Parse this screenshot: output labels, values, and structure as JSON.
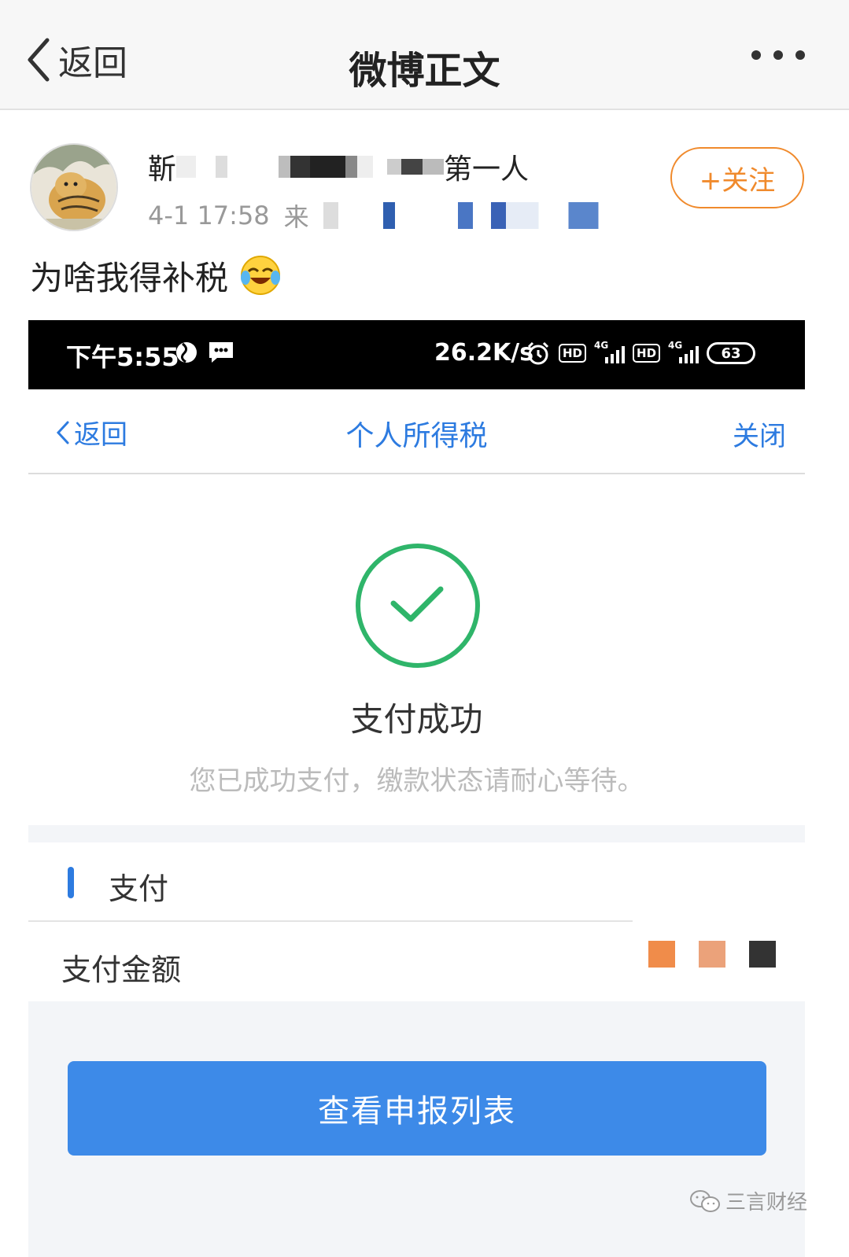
{
  "weibo_nav": {
    "back_label": "返回",
    "title": "微博正文"
  },
  "post": {
    "author_visible_start": "靳",
    "author_visible_end": "第一人",
    "time": "4-1 17:58",
    "source_prefix": "来",
    "follow_label": "+关注",
    "text": "为啥我得补税"
  },
  "status_bar": {
    "time": "下午5:55",
    "speed": "26.2K/s",
    "hd1": "HD",
    "net1": "4G",
    "hd2": "HD",
    "net2": "4G",
    "battery": "63"
  },
  "tax_page": {
    "back_label": "返回",
    "title": "个人所得税",
    "close_label": "关闭",
    "success_title": "支付成功",
    "success_sub": "您已成功支付，缴款状态请耐心等待。",
    "section_label": "支付",
    "amount_label": "支付金额",
    "primary_button": "查看申报列表"
  },
  "watermark": {
    "text": "三言财经"
  },
  "colors": {
    "weibo_orange": "#f08a2c",
    "tax_blue": "#2d7be0",
    "button_blue": "#3d8ae8",
    "success_green": "#2fb56a"
  }
}
